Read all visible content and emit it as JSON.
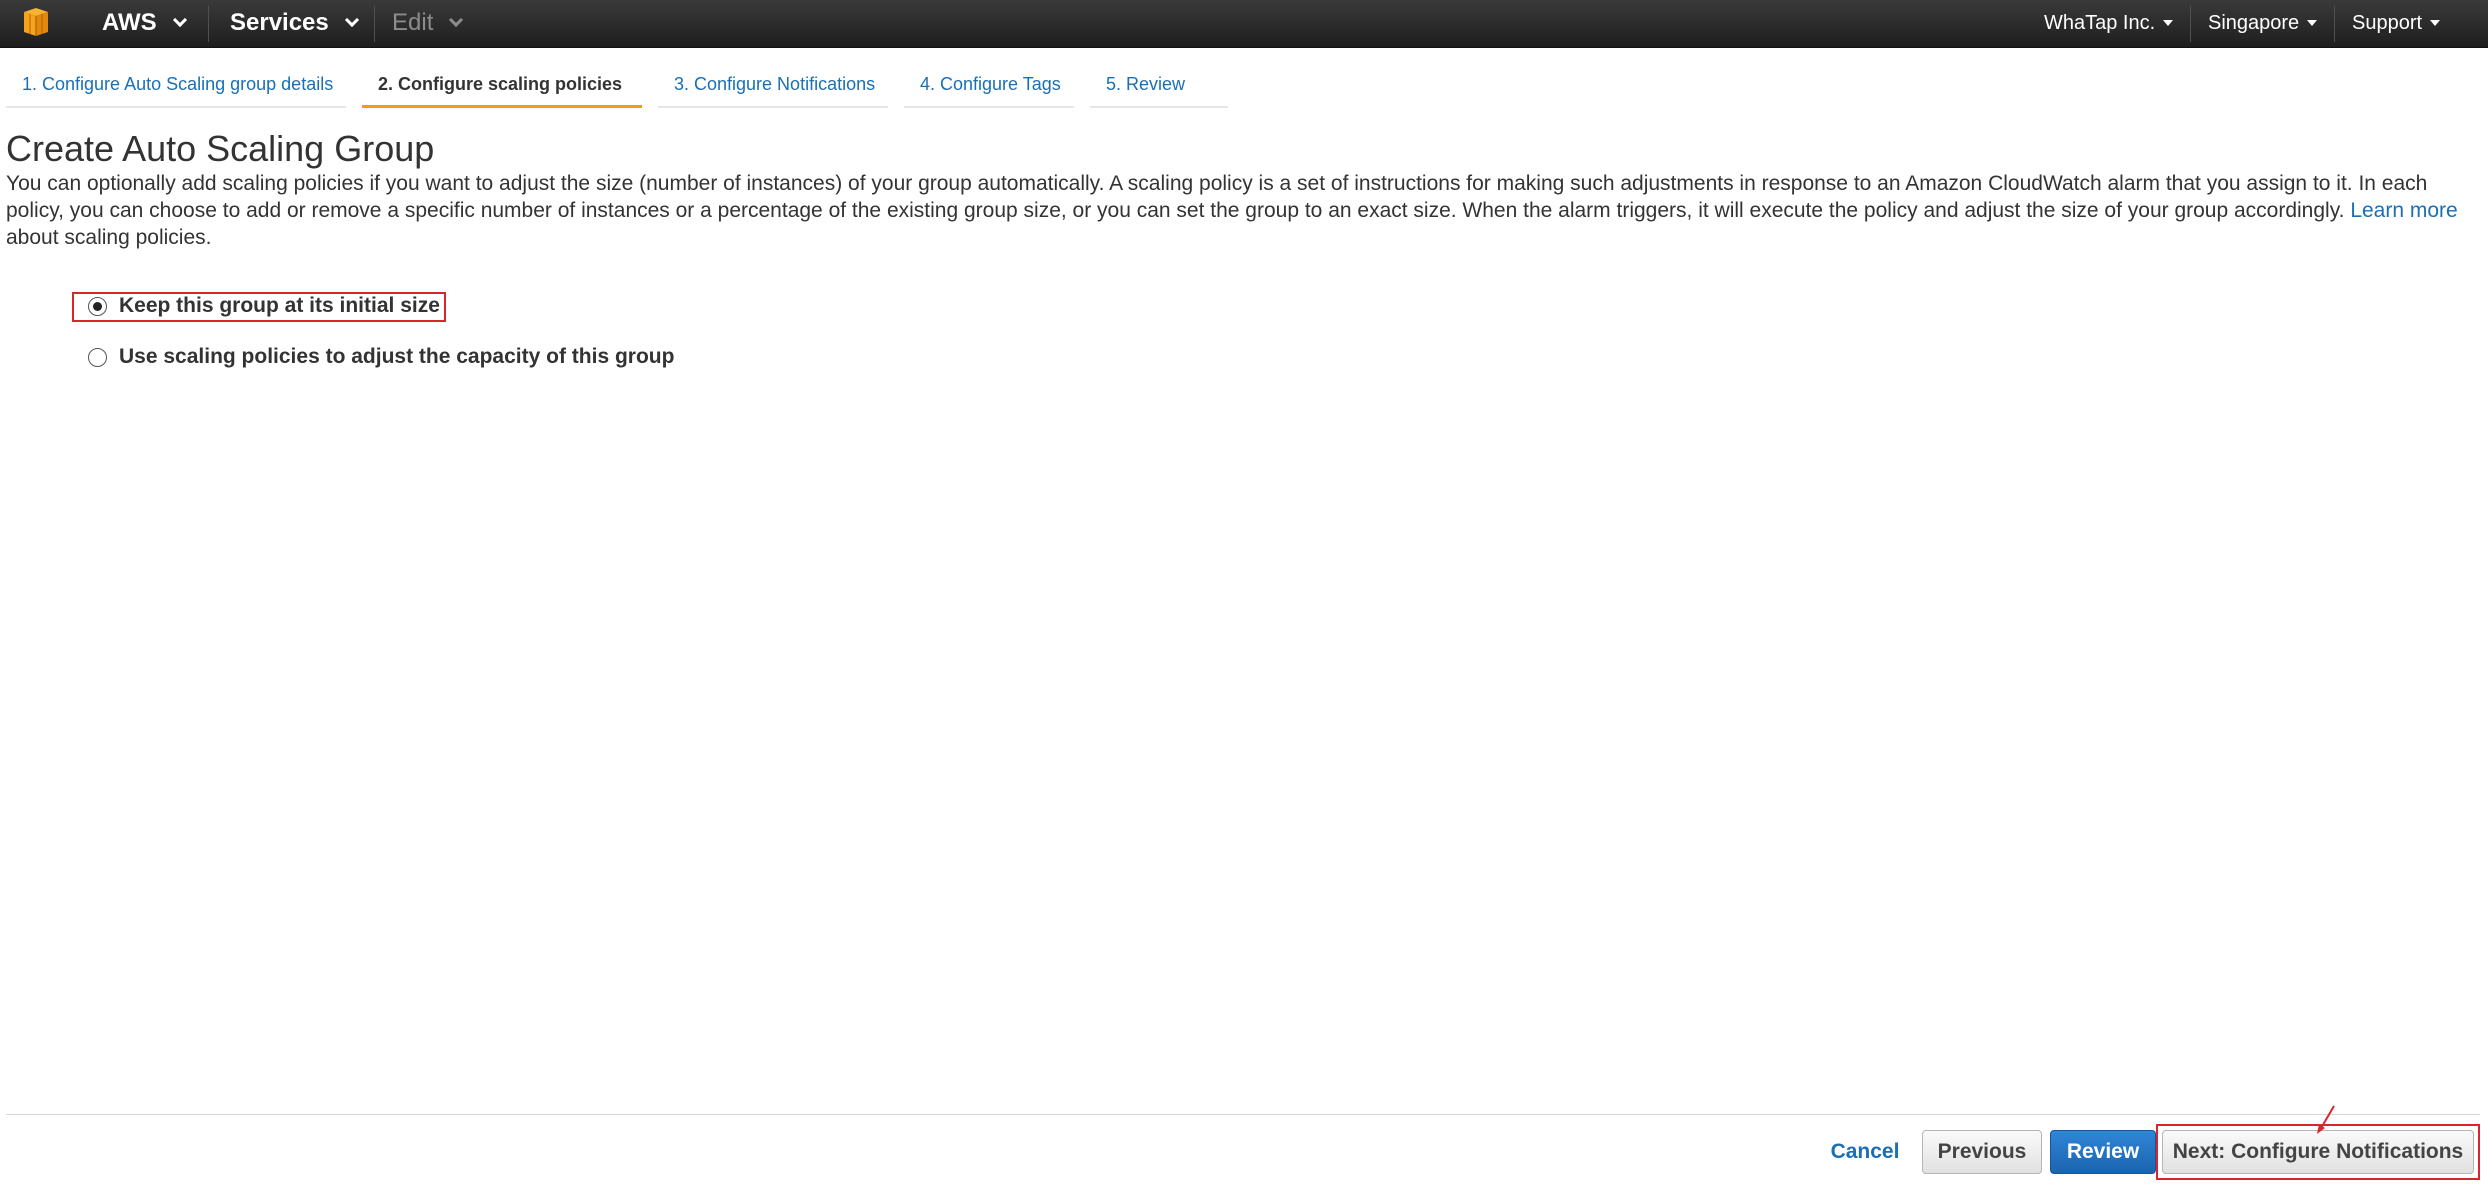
{
  "topbar": {
    "aws_label": "AWS",
    "services_label": "Services",
    "edit_label": "Edit",
    "account_label": "WhaTap Inc.",
    "region_label": "Singapore",
    "support_label": "Support",
    "logo_icon": "aws-cube-icon",
    "logo_color": "#f7a21b"
  },
  "wizard": {
    "tabs": [
      {
        "label": "1. Configure Auto Scaling group details",
        "active": false
      },
      {
        "label": "2. Configure scaling policies",
        "active": true
      },
      {
        "label": "3. Configure Notifications",
        "active": false
      },
      {
        "label": "4. Configure Tags",
        "active": false
      },
      {
        "label": "5. Review",
        "active": false
      }
    ]
  },
  "main": {
    "title": "Create Auto Scaling Group",
    "description": "You can optionally add scaling policies if you want to adjust the size (number of instances) of your group automatically. A scaling policy is a set of instructions for making such adjustments in response to an Amazon CloudWatch alarm that you assign to it. In each policy, you can choose to add or remove a specific number of instances or a percentage of the existing group size, or you can set the group to an exact size. When the alarm triggers, it will execute the policy and adjust the size of your group accordingly. ",
    "learn_more_link": "Learn more",
    "description_tail": "about scaling policies.",
    "options": [
      {
        "label": "Keep this group at its initial size",
        "selected": true
      },
      {
        "label": "Use scaling policies to adjust the capacity of this group",
        "selected": false
      }
    ]
  },
  "footer": {
    "cancel_label": "Cancel",
    "previous_label": "Previous",
    "review_label": "Review",
    "next_label": "Next: Configure Notifications"
  },
  "colors": {
    "accent_tab": "#f39c12",
    "link": "#1a6fb5",
    "primary_button": "#1b64b0",
    "annotation": "#d9262c"
  }
}
